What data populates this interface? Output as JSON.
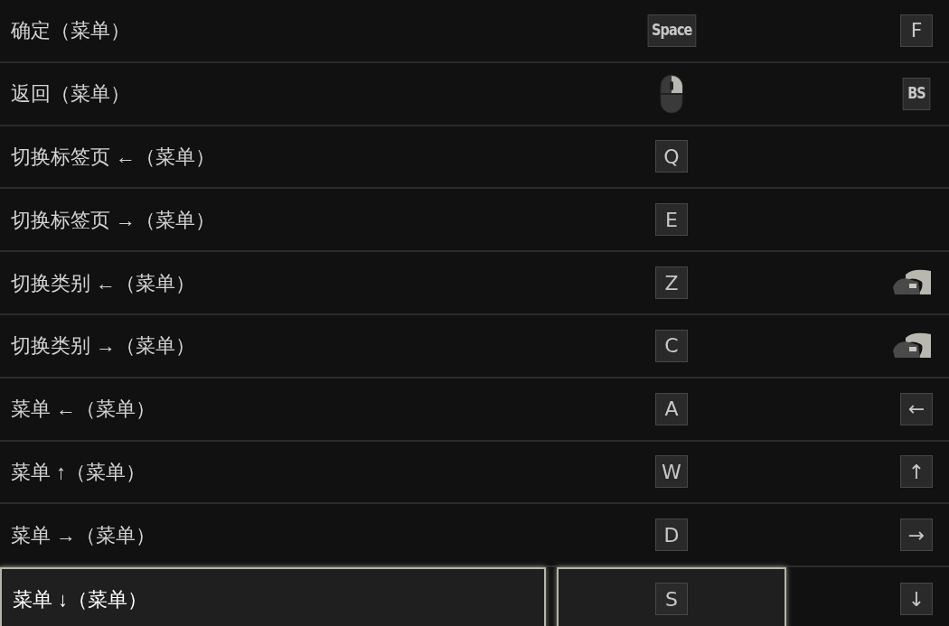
{
  "bindings": [
    {
      "action": "确定（菜单）",
      "selected": false,
      "primary": {
        "kind": "key",
        "label": "Space"
      },
      "secondary": {
        "kind": "key",
        "label": "F"
      }
    },
    {
      "action": "返回（菜单）",
      "selected": false,
      "primary": {
        "kind": "mouse"
      },
      "secondary": {
        "kind": "key",
        "label": "BS"
      }
    },
    {
      "action": "切换标签页 ←（菜单）",
      "selected": false,
      "primary": {
        "kind": "key",
        "label": "Q"
      }
    },
    {
      "action": "切换标签页 →（菜单）",
      "selected": false,
      "primary": {
        "kind": "key",
        "label": "E"
      }
    },
    {
      "action": "切换类别 ←（菜单）",
      "selected": false,
      "primary": {
        "kind": "key",
        "label": "Z"
      },
      "secondary": {
        "kind": "mouse-side"
      }
    },
    {
      "action": "切换类别 →（菜单）",
      "selected": false,
      "primary": {
        "kind": "key",
        "label": "C"
      },
      "secondary": {
        "kind": "mouse-side"
      }
    },
    {
      "action": "菜单 ←（菜单）",
      "selected": false,
      "primary": {
        "kind": "key",
        "label": "A"
      },
      "secondary": {
        "kind": "key",
        "label": "←"
      }
    },
    {
      "action": "菜单 ↑（菜单）",
      "selected": false,
      "primary": {
        "kind": "key",
        "label": "W"
      },
      "secondary": {
        "kind": "key",
        "label": "↑"
      }
    },
    {
      "action": "菜单 →（菜单）",
      "selected": false,
      "primary": {
        "kind": "key",
        "label": "D"
      },
      "secondary": {
        "kind": "key",
        "label": "→"
      }
    },
    {
      "action": "菜单 ↓（菜单）",
      "selected": true,
      "primary": {
        "kind": "key",
        "label": "S"
      },
      "secondary": {
        "kind": "key",
        "label": "↓"
      }
    }
  ]
}
